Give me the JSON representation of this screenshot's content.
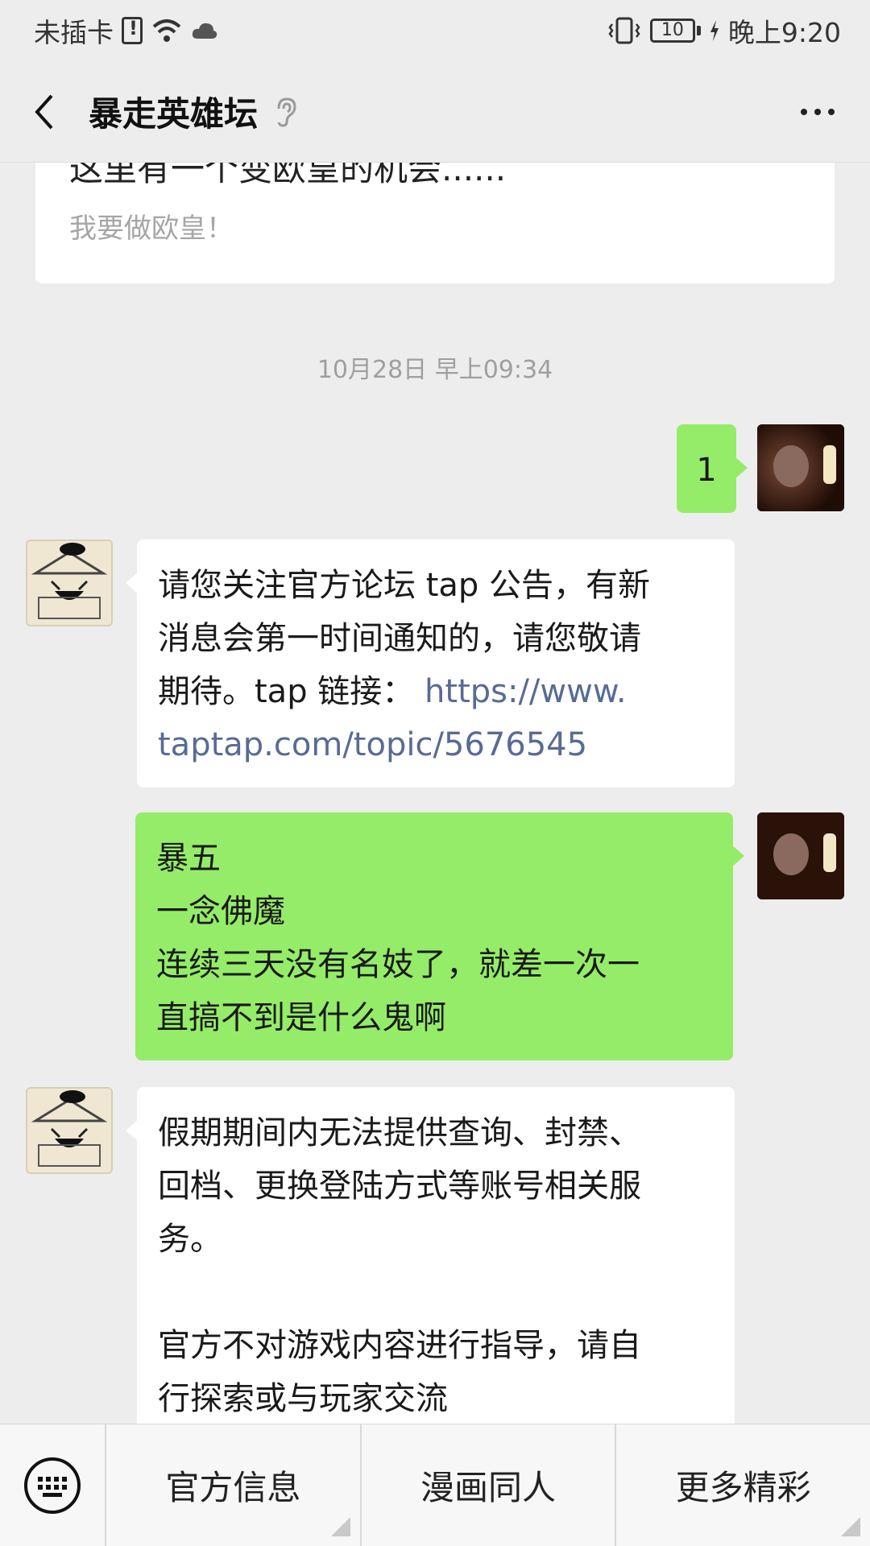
{
  "status_bar": {
    "carrier": "未插卡",
    "battery": "10",
    "time": "晚上9:20"
  },
  "nav": {
    "title": "暴走英雄坛"
  },
  "article_card": {
    "title": "这里有一个变欧皇的机会......",
    "link_text": "我要做欧皇！"
  },
  "timestamp": "10月28日 早上09:34",
  "messages": [
    {
      "from": "user",
      "lines": [
        "1"
      ]
    },
    {
      "from": "bot",
      "lines": [
        "请您关注官方论坛 tap 公告，有新",
        "消息会第一时间通知的，请您敬请",
        "期待。tap 链接："
      ],
      "link_inline": "https://www.",
      "link_line": "taptap.com/topic/5676545"
    },
    {
      "from": "user",
      "lines": [
        "暴五",
        "一念佛魔",
        "连续三天没有名妓了，就差一次一",
        "直搞不到是什么鬼啊"
      ]
    },
    {
      "from": "bot",
      "lines": [
        "假期期间内无法提供查询、封禁、",
        "回档、更换登陆方式等账号相关服",
        "务。",
        "",
        "官方不对游戏内容进行指导，请自",
        "行探索或与玩家交流"
      ]
    }
  ],
  "menu": {
    "items": [
      "官方信息",
      "漫画同人",
      "更多精彩"
    ]
  },
  "icons": {
    "back": "chevron-left-icon",
    "ear": "ear-icon",
    "more": "more-dots-icon",
    "keyboard": "keyboard-icon"
  },
  "colors": {
    "chat_bg": "#ededed",
    "sent_bubble": "#95ec69",
    "received_bubble": "#ffffff",
    "link": "#576b95"
  }
}
